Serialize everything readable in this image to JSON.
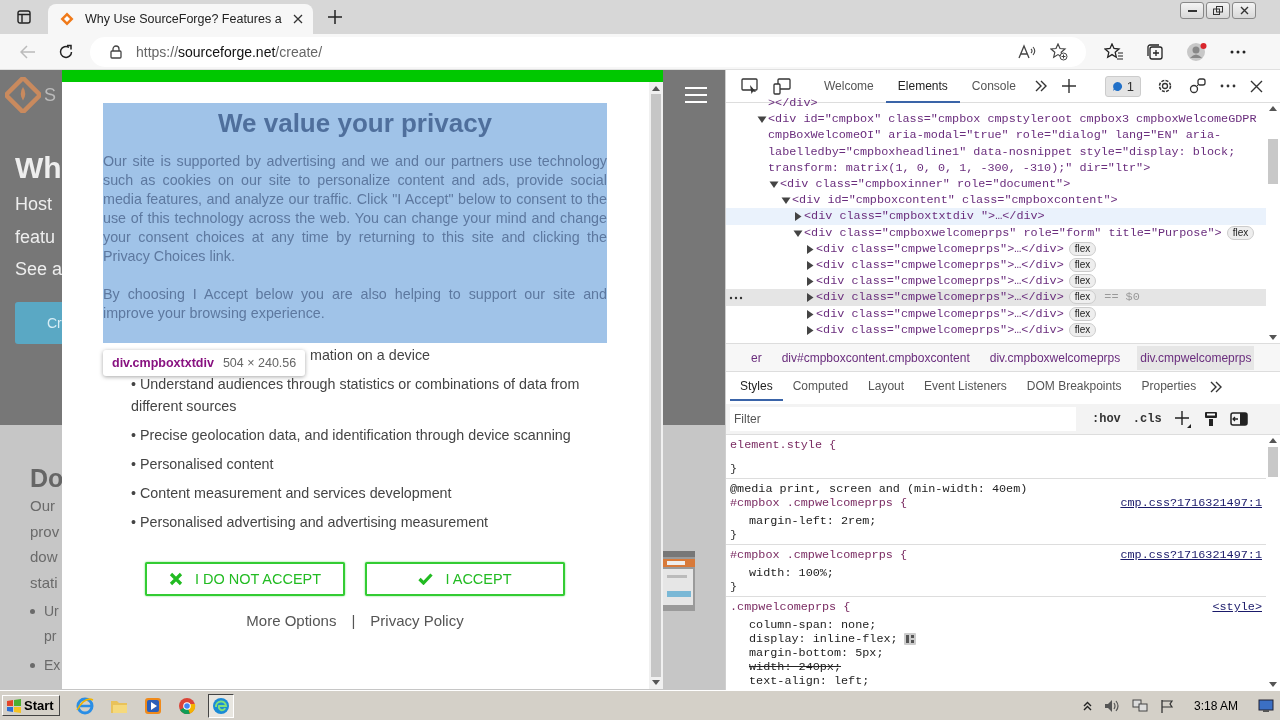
{
  "browser": {
    "tabs": [
      {
        "title": "Why Use SourceForge? Features a",
        "selected": true
      }
    ],
    "url": {
      "scheme": "https://",
      "host": "sourceforge.net",
      "path": "/create/"
    }
  },
  "page": {
    "logo_text": "S",
    "hero_title": "Wh",
    "hero_lines": [
      "Host",
      "featu",
      "See a"
    ],
    "hero_button": "Cr",
    "section_title": "Do",
    "paragraph_lines": [
      "Our",
      "prov",
      "dow",
      "stati"
    ],
    "bullets": [
      {
        "lines": [
          "Ur",
          "pr"
        ]
      },
      {
        "lines": [
          "Ex"
        ]
      }
    ]
  },
  "consent": {
    "title": "We value your privacy",
    "paragraphs": [
      "Our site is supported by advertising and we and our partners use technology such as cookies on our site to personalize content and ads, provide social media features, and analyze our traffic. Click \"I Accept\" below to consent to the use of this technology across the web. You can change your mind and change your consent choices at any time by returning to this site and clicking the Privacy Choices link.",
      "By choosing I Accept below you are also helping to support our site and improve your browsing experience."
    ],
    "inspect_tooltip": {
      "selector": "div.cmpboxtxtdiv",
      "size": "504 × 240.56"
    },
    "purposes": [
      {
        "text": "mation on a device",
        "covered": true
      },
      {
        "text": "• Understand audiences through statistics or combinations of data from different sources",
        "covered": false
      },
      {
        "text": "• Precise geolocation data, and identification through device scanning",
        "covered": false
      },
      {
        "text": "• Personalised content",
        "covered": false
      },
      {
        "text": "• Content measurement and services development",
        "covered": false
      },
      {
        "text": "• Personalised advertising and advertising measurement",
        "covered": false
      }
    ],
    "buttons": [
      {
        "kind": "reject",
        "label": "I DO NOT ACCEPT"
      },
      {
        "kind": "accept",
        "label": "I ACCEPT"
      }
    ],
    "links": [
      "More Options",
      "Privacy Policy"
    ],
    "link_separator": "|"
  },
  "devtools": {
    "tabs": [
      {
        "label": "Welcome",
        "selected": false
      },
      {
        "label": "Elements",
        "selected": true
      },
      {
        "label": "Console",
        "selected": false
      }
    ],
    "issues_count": "1",
    "dom": [
      {
        "kind": "closing",
        "text": "></div>",
        "selected": false,
        "hovered": false
      },
      {
        "kind": "element",
        "text": "<div id=\"cmpbox\" class=\"cmpbox cmpstyleroot cmpbox3 cmpboxWelcomeGDPR cmpBoxWelcomeOI\" aria-modal=\"true\" role=\"dialog\" lang=\"EN\" aria-labelledby=\"cmpboxheadline1\" data-nosnippet style=\"display: block; transform: matrix(1, 0, 0, 1, -300, -310);\" dir=\"ltr\">",
        "expanded": true,
        "selected": false,
        "hovered": false,
        "children": [
          {
            "kind": "element",
            "text": "<div class=\"cmpboxinner\" role=\"document\">",
            "expanded": true,
            "selected": false,
            "hovered": false,
            "children": [
              {
                "kind": "element",
                "text": "<div id=\"cmpboxcontent\" class=\"cmpboxcontent\">",
                "expanded": true,
                "selected": false,
                "hovered": false,
                "children": [
                  {
                    "kind": "element",
                    "text": "<div class=\"cmpboxtxtdiv \">…</div>",
                    "expanded": false,
                    "selected": false,
                    "hovered": true
                  },
                  {
                    "kind": "element",
                    "text": "<div class=\"cmpboxwelcomeprps\" role=\"form\" title=\"Purpose\">",
                    "badge": "flex",
                    "expanded": true,
                    "selected": false,
                    "hovered": false,
                    "children": [
                      {
                        "kind": "element",
                        "text": "<div class=\"cmpwelcomeprps\">…</div>",
                        "badge": "flex",
                        "expanded": false,
                        "selected": false,
                        "hovered": false
                      },
                      {
                        "kind": "element",
                        "text": "<div class=\"cmpwelcomeprps\">…</div>",
                        "badge": "flex",
                        "expanded": false,
                        "selected": false,
                        "hovered": false
                      },
                      {
                        "kind": "element",
                        "text": "<div class=\"cmpwelcomeprps\">…</div>",
                        "badge": "flex",
                        "expanded": false,
                        "selected": false,
                        "hovered": false
                      },
                      {
                        "kind": "element",
                        "text": "<div class=\"cmpwelcomeprps\">…</div>",
                        "badge": "flex",
                        "suffix": "== $0",
                        "expanded": false,
                        "selected": true,
                        "hovered": false
                      },
                      {
                        "kind": "element",
                        "text": "<div class=\"cmpwelcomeprps\">…</div>",
                        "badge": "flex",
                        "expanded": false,
                        "selected": false,
                        "hovered": false
                      },
                      {
                        "kind": "element",
                        "text": "<div class=\"cmpwelcomeprps\">…</div>",
                        "badge": "flex",
                        "expanded": false,
                        "selected": false,
                        "hovered": false
                      }
                    ]
                  }
                ]
              }
            ]
          }
        ]
      }
    ],
    "breadcrumbs": [
      {
        "label": "er",
        "selected": false
      },
      {
        "label": "div#cmpboxcontent.cmpboxcontent",
        "selected": false
      },
      {
        "label": "div.cmpboxwelcomeprps",
        "selected": false
      },
      {
        "label": "div.cmpwelcomeprps",
        "selected": true
      }
    ],
    "subtabs": [
      {
        "label": "Styles",
        "selected": true
      },
      {
        "label": "Computed",
        "selected": false
      },
      {
        "label": "Layout",
        "selected": false
      },
      {
        "label": "Event Listeners",
        "selected": false
      },
      {
        "label": "DOM Breakpoints",
        "selected": false
      },
      {
        "label": "Properties",
        "selected": false
      }
    ],
    "filter_placeholder": "Filter",
    "hov": ":hov",
    "cls": ".cls",
    "rules": [
      {
        "selector": "element.style {",
        "close": "}"
      },
      {
        "media": "@media print, screen and (min-width: 40em)",
        "selector": "#cmpbox .cmpwelcomeprps {",
        "source": "cmp.css?1716321497:1",
        "declarations": [
          {
            "text": "margin-left: 2rem;",
            "struck": false,
            "flex_editor": false
          }
        ],
        "close": "}"
      },
      {
        "selector": "#cmpbox .cmpwelcomeprps {",
        "source": "cmp.css?1716321497:1",
        "declarations": [
          {
            "text": "width: 100%;",
            "struck": false,
            "flex_editor": false
          }
        ],
        "close": "}"
      },
      {
        "selector": ".cmpwelcomeprps {",
        "source": "<style>",
        "declarations": [
          {
            "text": "column-span: none;",
            "struck": false,
            "flex_editor": false
          },
          {
            "text": "display: inline-flex;",
            "struck": false,
            "flex_editor": true
          },
          {
            "text": "margin-bottom: 5px;",
            "struck": false,
            "flex_editor": false
          },
          {
            "text": "width: 240px;",
            "struck": true,
            "flex_editor": false
          },
          {
            "text": "text-align: left;",
            "struck": false,
            "flex_editor": false
          }
        ]
      }
    ]
  },
  "taskbar": {
    "start": "Start",
    "apps": [
      {
        "kind": "ie",
        "selected": false
      },
      {
        "kind": "folder",
        "selected": false
      },
      {
        "kind": "media",
        "selected": false
      },
      {
        "kind": "chrome",
        "selected": false
      },
      {
        "kind": "edge",
        "selected": true
      }
    ],
    "clock": "3:18 AM"
  }
}
